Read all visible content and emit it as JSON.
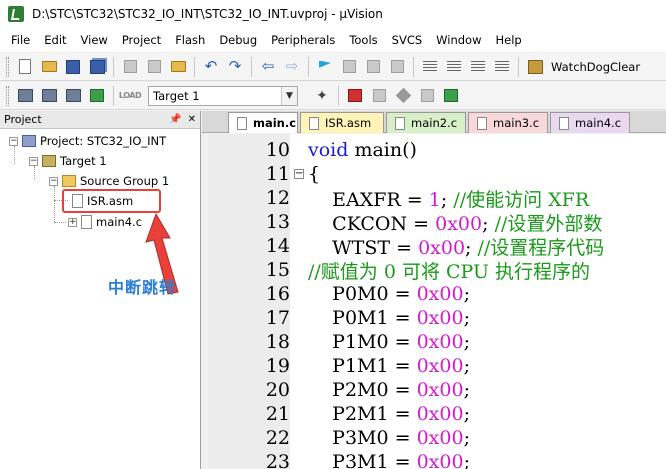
{
  "window": {
    "title": "D:\\STC\\STC32\\STC32_IO_INT\\STC32_IO_INT.uvproj - µVision"
  },
  "menu": [
    "File",
    "Edit",
    "View",
    "Project",
    "Flash",
    "Debug",
    "Peripherals",
    "Tools",
    "SVCS",
    "Window",
    "Help"
  ],
  "toolbar": {
    "watchdog_label": "WatchDogClear",
    "target_value": "Target 1",
    "load_label": "LOAD"
  },
  "project_panel": {
    "title": "Project",
    "root": "Project: STC32_IO_INT",
    "target": "Target 1",
    "group": "Source Group 1",
    "files": [
      "ISR.asm",
      "main4.c"
    ]
  },
  "annotation": "中断跳转",
  "tabs": [
    {
      "label": "main.c",
      "color": "#ffffff"
    },
    {
      "label": "ISR.asm",
      "color": "#fff4b8"
    },
    {
      "label": "main2.c",
      "color": "#d8f0c8"
    },
    {
      "label": "main3.c",
      "color": "#f8d8d8"
    },
    {
      "label": "main4.c",
      "color": "#e8d8f0"
    }
  ],
  "code_lines": [
    {
      "ln": "10",
      "fold": "",
      "code": "void main()"
    },
    {
      "ln": "11",
      "fold": "−",
      "code": "{"
    },
    {
      "ln": "12",
      "fold": "",
      "code": "    EAXFR = 1; //使能访问 XFR"
    },
    {
      "ln": "13",
      "fold": "",
      "code": "    CKCON = 0x00; //设置外部数"
    },
    {
      "ln": "14",
      "fold": "",
      "code": "    WTST = 0x00; //设置程序代码"
    },
    {
      "ln": "15",
      "fold": "",
      "code": "//赋值为 0 可将 CPU 执行程序的"
    },
    {
      "ln": "16",
      "fold": "",
      "code": "    P0M0 = 0x00;"
    },
    {
      "ln": "17",
      "fold": "",
      "code": "    P0M1 = 0x00;"
    },
    {
      "ln": "18",
      "fold": "",
      "code": "    P1M0 = 0x00;"
    },
    {
      "ln": "19",
      "fold": "",
      "code": "    P1M1 = 0x00;"
    },
    {
      "ln": "20",
      "fold": "",
      "code": "    P2M0 = 0x00;"
    },
    {
      "ln": "21",
      "fold": "",
      "code": "    P2M1 = 0x00;"
    },
    {
      "ln": "22",
      "fold": "",
      "code": "    P3M0 = 0x00;"
    },
    {
      "ln": "23",
      "fold": "",
      "code": "    P3M1 = 0x00;"
    }
  ],
  "colors": {
    "keyword": "#1a1ad6",
    "number": "#d01ad0",
    "comment": "#1a9a1a",
    "highlight": "#e8403a",
    "annotation": "#2a7fd6"
  }
}
